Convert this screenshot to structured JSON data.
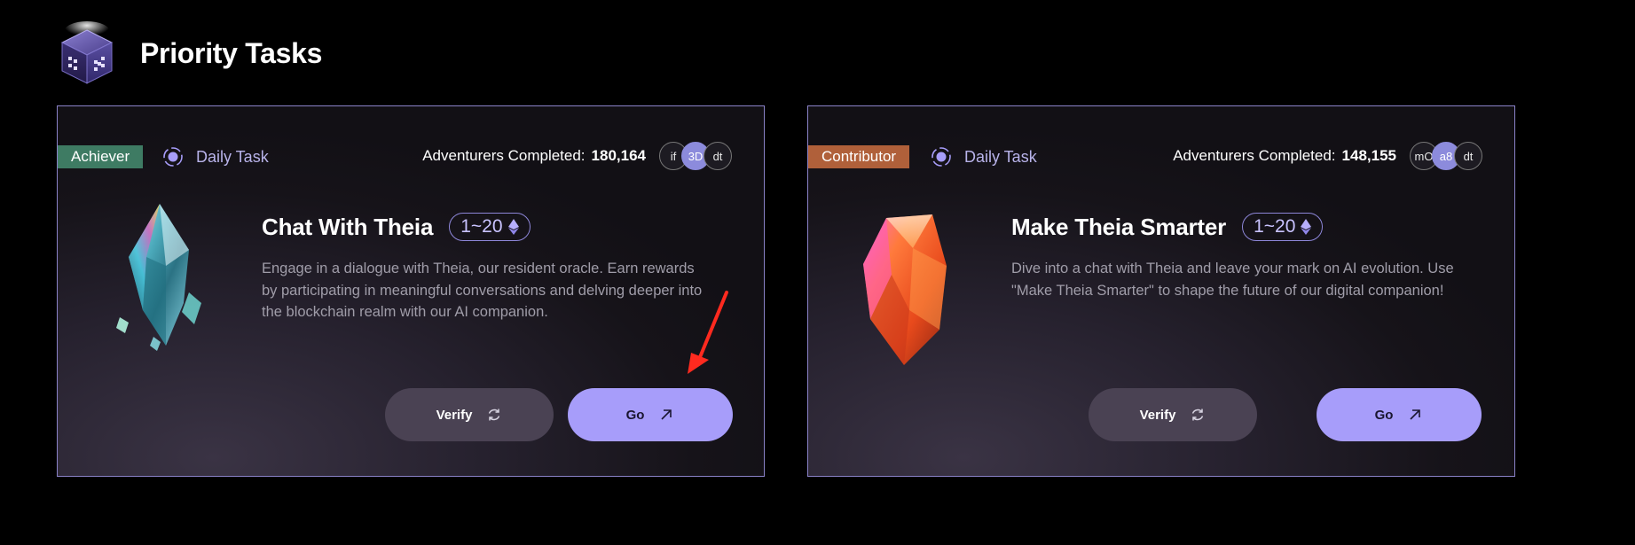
{
  "header": {
    "title": "Priority Tasks",
    "logo_icon": "cube-logo-icon"
  },
  "cards": [
    {
      "badge": "Achiever",
      "badge_color": "#3e7b63",
      "daily_label": "Daily Task",
      "completed_label": "Adventurers Completed:",
      "completed_count": "180,164",
      "avatars": [
        "if",
        "3D",
        "dt"
      ],
      "title": "Chat With Theia",
      "range": "1~20",
      "description": "Engage in a dialogue with Theia, our resident oracle. Earn rewards by participating in meaningful conversations and delving deeper into the blockchain realm with our AI companion.",
      "verify_label": "Verify",
      "go_label": "Go",
      "crystal_icon": "blue-crystal-icon"
    },
    {
      "badge": "Contributor",
      "badge_color": "#b0603a",
      "daily_label": "Daily Task",
      "completed_label": "Adventurers Completed:",
      "completed_count": "148,155",
      "avatars": [
        "mO",
        "a8",
        "dt"
      ],
      "title": "Make Theia Smarter",
      "range": "1~20",
      "description": "Dive into a chat with Theia and leave your mark on AI evolution. Use \"Make Theia Smarter\" to shape the future of our digital companion!",
      "verify_label": "Verify",
      "go_label": "Go",
      "crystal_icon": "orange-crystal-icon"
    }
  ],
  "colors": {
    "accent": "#a79dfa",
    "card_border": "#8a82c8",
    "annotation_arrow": "#ff2a1f"
  }
}
